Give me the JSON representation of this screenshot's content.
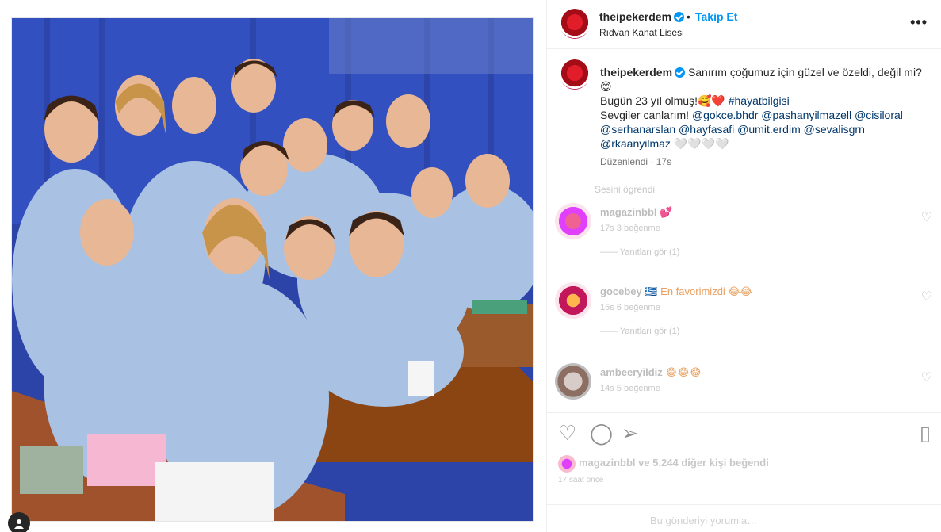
{
  "post": {
    "username": "theipekerdem",
    "follow_label": "Takip Et",
    "dot": "•",
    "location": "Rıdvan Kanat Lisesi",
    "more_label": "•••"
  },
  "caption": {
    "username": "theipekerdem",
    "line1": "Sanırım çoğumuz için güzel ve özeldi, değil mi?",
    "line1_emoji": "😊",
    "line2": "Bugün 23 yıl olmuş!🥰❤️",
    "hashtag": "#hayatbilgisi",
    "line3": "Sevgiler canlarım!",
    "mentions_line3": "@gokce.bhdr @pashanyilmazell @cisiloral",
    "mentions_line4": "@serhanarslan @hayfasafi @umit.erdim @sevalisgrn",
    "mentions_line5": "@rkaanyilmaz",
    "trailing": "🤍🤍🤍🤍",
    "edited": "Düzenlendi",
    "time": "17s"
  },
  "comments": {
    "see_translation": "Sesini ögrendi",
    "items": [
      {
        "name": "magazinbbl",
        "emoji": "💕",
        "meta": "17s  3 beğenme",
        "replies": "—— Yanıtları gör (1)",
        "avatar_color": "#d81b9a"
      },
      {
        "name": "gocebey",
        "emoji": "🇬🇷 En favorimizdi 😂😂",
        "meta": "15s  6 beğenme",
        "replies": "—— Yanıtları gör (1)",
        "avatar_color": "#c2185b"
      },
      {
        "name": "ambeeryildiz",
        "emoji": "😂😂😂",
        "meta": "14s  5 beğenme",
        "replies": "",
        "avatar_color": "#9e9e9e"
      }
    ]
  },
  "likes": {
    "text": "magazinbbl ve 5.244 diğer kişi beğendi",
    "time": "17 saat önce"
  },
  "add_comment": {
    "placeholder": "Bu gönderiyi yorumla…"
  },
  "icons": {
    "heart": "heart-icon",
    "comment": "comment-icon",
    "share": "share-icon",
    "save": "bookmark-icon",
    "more": "more-icon",
    "verified": "verified-badge-icon"
  },
  "colors": {
    "accent": "#0095f6",
    "link": "#00376b",
    "muted": "#737373"
  }
}
